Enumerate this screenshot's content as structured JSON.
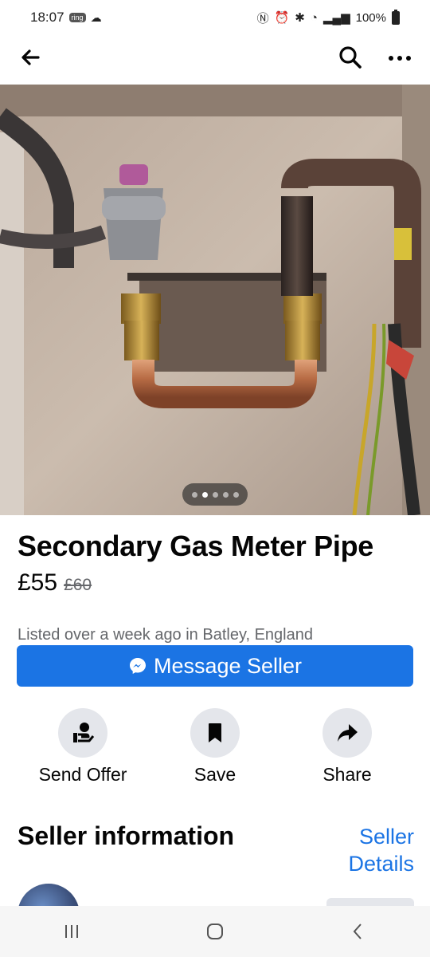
{
  "status_bar": {
    "time": "18:07",
    "ring_badge": "ring",
    "battery": "100%"
  },
  "listing": {
    "title": "Secondary Gas Meter Pipe",
    "price": "£55",
    "original_price": "£60",
    "listed_text": "Listed over a week ago in Batley, England",
    "photo_index": 2,
    "photo_count": 5
  },
  "actions": {
    "message_seller": "Message Seller",
    "send_offer": "Send Offer",
    "save": "Save",
    "share": "Share"
  },
  "seller": {
    "heading": "Seller information",
    "details_link": "Seller Details"
  },
  "colors": {
    "accent": "#1b74e4",
    "secondary_text": "#65676b",
    "button_bg": "#e4e6eb"
  }
}
